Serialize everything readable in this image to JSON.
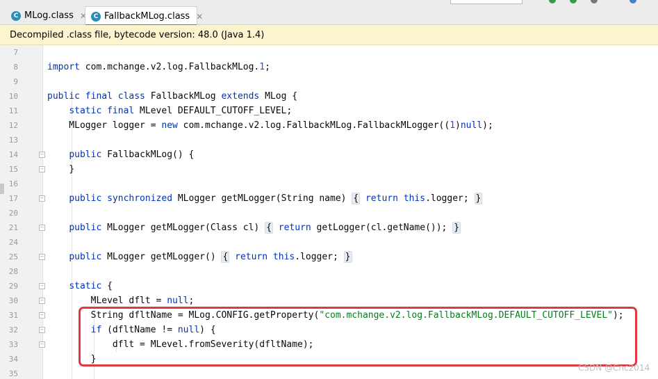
{
  "tabs": [
    {
      "icon": "C",
      "label": "MLog.class",
      "close": "✕"
    },
    {
      "icon": "C",
      "label": "FallbackMLog.class",
      "close": "✕"
    }
  ],
  "banner": {
    "text": "Decompiled .class file, bytecode version: 48.0 (Java 1.4)"
  },
  "code": {
    "lines": [
      {
        "no": "7"
      },
      {
        "no": "8",
        "tokens": [
          {
            "k": "kw",
            "t": "import"
          },
          {
            "t": " com.mchange.v2.log.FallbackMLog."
          },
          {
            "k": "num",
            "t": "1"
          },
          {
            "t": ";"
          }
        ]
      },
      {
        "no": "9"
      },
      {
        "no": "10",
        "tokens": [
          {
            "k": "kw",
            "t": "public final class"
          },
          {
            "t": " FallbackMLog "
          },
          {
            "k": "kw",
            "t": "extends"
          },
          {
            "t": " MLog {"
          }
        ]
      },
      {
        "no": "11",
        "tokens": [
          {
            "t": "    "
          },
          {
            "k": "kw",
            "t": "static final"
          },
          {
            "t": " MLevel DEFAULT_CUTOFF_LEVEL;"
          }
        ]
      },
      {
        "no": "12",
        "tokens": [
          {
            "t": "    MLogger logger = "
          },
          {
            "k": "kw",
            "t": "new"
          },
          {
            "t": " com.mchange.v2.log.FallbackMLog.FallbackMLogger(("
          },
          {
            "k": "num",
            "t": "1"
          },
          {
            "t": ")"
          },
          {
            "k": "kw",
            "t": "null"
          },
          {
            "t": ");"
          }
        ]
      },
      {
        "no": "13"
      },
      {
        "no": "14",
        "tokens": [
          {
            "t": "    "
          },
          {
            "k": "kw",
            "t": "public"
          },
          {
            "t": " FallbackMLog() {"
          }
        ]
      },
      {
        "no": "15",
        "tokens": [
          {
            "t": "    }"
          }
        ]
      },
      {
        "no": "16"
      },
      {
        "no": "17",
        "tokens": [
          {
            "t": "    "
          },
          {
            "k": "kw",
            "t": "public synchronized"
          },
          {
            "t": " MLogger getMLogger(String name) "
          },
          {
            "k": "fb",
            "t": "{"
          },
          {
            "t": " "
          },
          {
            "k": "kw",
            "t": "return this"
          },
          {
            "t": ".logger; "
          },
          {
            "k": "fb",
            "t": "}"
          }
        ]
      },
      {
        "no": "20"
      },
      {
        "no": "21",
        "tokens": [
          {
            "t": "    "
          },
          {
            "k": "kw",
            "t": "public"
          },
          {
            "t": " MLogger getMLogger(Class cl) "
          },
          {
            "k": "fb",
            "t": "{"
          },
          {
            "t": " "
          },
          {
            "k": "kw",
            "t": "return"
          },
          {
            "t": " getLogger(cl.getName()); "
          },
          {
            "k": "fb",
            "t": "}"
          }
        ]
      },
      {
        "no": "24"
      },
      {
        "no": "25",
        "tokens": [
          {
            "t": "    "
          },
          {
            "k": "kw",
            "t": "public"
          },
          {
            "t": " MLogger getMLogger() "
          },
          {
            "k": "fb",
            "t": "{"
          },
          {
            "t": " "
          },
          {
            "k": "kw",
            "t": "return this"
          },
          {
            "t": ".logger; "
          },
          {
            "k": "fb",
            "t": "}"
          }
        ]
      },
      {
        "no": "28"
      },
      {
        "no": "29",
        "tokens": [
          {
            "t": "    "
          },
          {
            "k": "kw",
            "t": "static"
          },
          {
            "t": " {"
          }
        ]
      },
      {
        "no": "30",
        "tokens": [
          {
            "t": "        MLevel dflt = "
          },
          {
            "k": "kw",
            "t": "null"
          },
          {
            "t": ";"
          }
        ]
      },
      {
        "no": "31",
        "tokens": [
          {
            "t": "        String dfltName = MLog.CONFIG.getProperty("
          },
          {
            "k": "str",
            "t": "\"com.mchange.v2.log.FallbackMLog.DEFAULT_CUTOFF_LEVEL\""
          },
          {
            "t": ");"
          }
        ]
      },
      {
        "no": "32",
        "tokens": [
          {
            "t": "        "
          },
          {
            "k": "kw",
            "t": "if"
          },
          {
            "t": " (dfltName != "
          },
          {
            "k": "kw",
            "t": "null"
          },
          {
            "t": ") {"
          }
        ]
      },
      {
        "no": "33",
        "tokens": [
          {
            "t": "            dflt = MLevel.fromSeverity(dfltName);"
          }
        ]
      },
      {
        "no": "34",
        "tokens": [
          {
            "t": "        }"
          }
        ]
      },
      {
        "no": "35"
      }
    ]
  },
  "watermark": "CSDN @Cnc2014",
  "colors": {
    "keyword": "#0033b3",
    "string": "#067d17",
    "number": "#1750eb",
    "highlight": "#e0393d",
    "banner": "#fcf3cf"
  }
}
